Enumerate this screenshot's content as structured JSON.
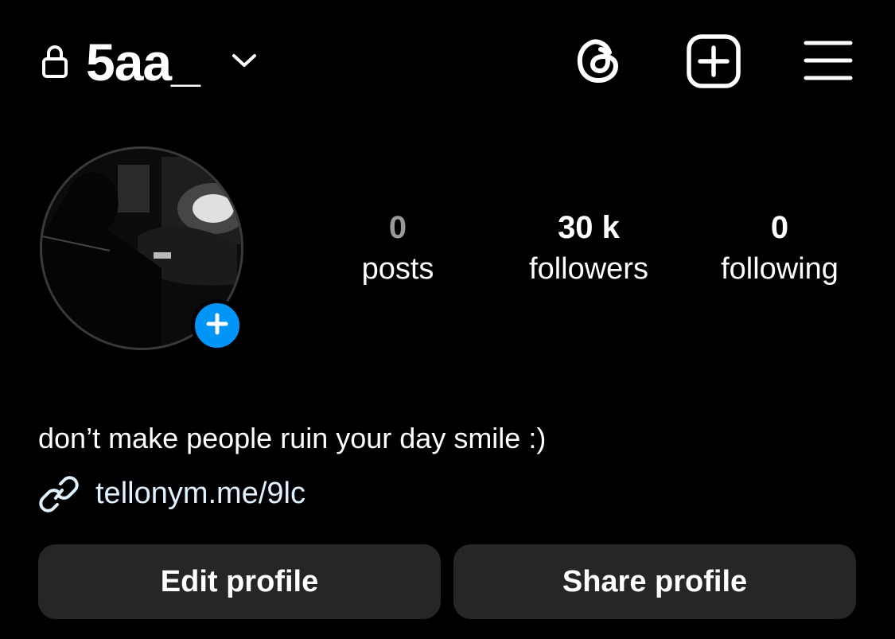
{
  "header": {
    "lock_icon": "lock-icon",
    "username": "5aa_",
    "chevron_icon": "chevron-down-icon",
    "threads_icon": "threads-icon",
    "create_icon": "plus-square-icon",
    "menu_icon": "hamburger-menu-icon"
  },
  "profile": {
    "avatar_add_icon": "plus-icon",
    "accent_color": "#0095f6",
    "stats": {
      "posts": {
        "value": "0",
        "label": "posts"
      },
      "followers": {
        "value": "30 k",
        "label": "followers"
      },
      "following": {
        "value": "0",
        "label": "following"
      }
    },
    "bio": "don’t make people ruin your day smile :)",
    "link": {
      "icon": "link-icon",
      "text": "tellonym.me/9lc"
    }
  },
  "actions": {
    "edit_label": "Edit profile",
    "share_label": "Share profile"
  }
}
